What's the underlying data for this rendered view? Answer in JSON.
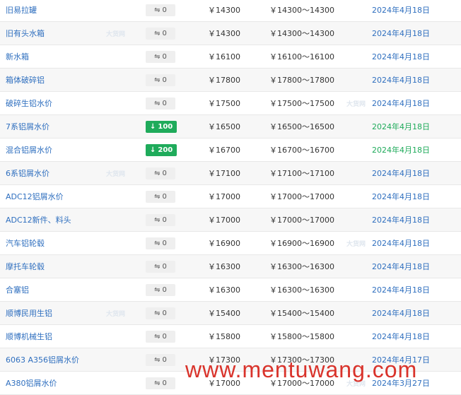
{
  "rows": [
    {
      "name": "旧易拉罐",
      "change": "0",
      "change_type": "flat",
      "price": "￥14300",
      "range": "￥14300～14300",
      "date": "2024年4月18日",
      "date_color": "blue"
    },
    {
      "name": "旧有头水箱",
      "change": "0",
      "change_type": "flat",
      "price": "￥14300",
      "range": "￥14300～14300",
      "date": "2024年4月18日",
      "date_color": "blue"
    },
    {
      "name": "新水箱",
      "change": "0",
      "change_type": "flat",
      "price": "￥16100",
      "range": "￥16100～16100",
      "date": "2024年4月18日",
      "date_color": "blue"
    },
    {
      "name": "箱体破碎铝",
      "change": "0",
      "change_type": "flat",
      "price": "￥17800",
      "range": "￥17800～17800",
      "date": "2024年4月18日",
      "date_color": "blue"
    },
    {
      "name": "破碎生铝水价",
      "change": "0",
      "change_type": "flat",
      "price": "￥17500",
      "range": "￥17500～17500",
      "date": "2024年4月18日",
      "date_color": "blue"
    },
    {
      "name": "7系铝屑水价",
      "change": "100",
      "change_type": "down",
      "price": "￥16500",
      "range": "￥16500～16500",
      "date": "2024年4月18日",
      "date_color": "green"
    },
    {
      "name": "混合铝屑水价",
      "change": "200",
      "change_type": "down",
      "price": "￥16700",
      "range": "￥16700～16700",
      "date": "2024年4月18日",
      "date_color": "green"
    },
    {
      "name": "6系铝屑水价",
      "change": "0",
      "change_type": "flat",
      "price": "￥17100",
      "range": "￥17100～17100",
      "date": "2024年4月18日",
      "date_color": "blue"
    },
    {
      "name": "ADC12铝屑水价",
      "change": "0",
      "change_type": "flat",
      "price": "￥17000",
      "range": "￥17000～17000",
      "date": "2024年4月18日",
      "date_color": "blue"
    },
    {
      "name": "ADC12新件、料头",
      "change": "0",
      "change_type": "flat",
      "price": "￥17000",
      "range": "￥17000～17000",
      "date": "2024年4月18日",
      "date_color": "blue"
    },
    {
      "name": "汽车铝轮毂",
      "change": "0",
      "change_type": "flat",
      "price": "￥16900",
      "range": "￥16900～16900",
      "date": "2024年4月18日",
      "date_color": "blue"
    },
    {
      "name": "摩托车轮毂",
      "change": "0",
      "change_type": "flat",
      "price": "￥16300",
      "range": "￥16300～16300",
      "date": "2024年4月18日",
      "date_color": "blue"
    },
    {
      "name": "合塞铝",
      "change": "0",
      "change_type": "flat",
      "price": "￥16300",
      "range": "￥16300～16300",
      "date": "2024年4月18日",
      "date_color": "blue"
    },
    {
      "name": "顺博民用生铝",
      "change": "0",
      "change_type": "flat",
      "price": "￥15400",
      "range": "￥15400～15400",
      "date": "2024年4月18日",
      "date_color": "blue"
    },
    {
      "name": "顺博机械生铝",
      "change": "0",
      "change_type": "flat",
      "price": "￥15800",
      "range": "￥15800～15800",
      "date": "2024年4月18日",
      "date_color": "blue"
    },
    {
      "name": "6063 A356铝屑水价",
      "change": "0",
      "change_type": "flat",
      "price": "￥17300",
      "range": "￥17300～17300",
      "date": "2024年4月17日",
      "date_color": "blue"
    },
    {
      "name": "A380铝屑水价",
      "change": "0",
      "change_type": "flat",
      "price": "￥17000",
      "range": "￥17000～17000",
      "date": "2024年3月27日",
      "date_color": "blue"
    }
  ],
  "icons": {
    "flat": "flat-arrow-icon",
    "down": "down-arrow-icon"
  },
  "colors": {
    "link_blue": "#2f6fbf",
    "down_green": "#1fab5b",
    "overlay_red": "#d9332b"
  },
  "watermarks": {
    "site": "大货网",
    "overlay_url": "www.mentuwang.com"
  }
}
